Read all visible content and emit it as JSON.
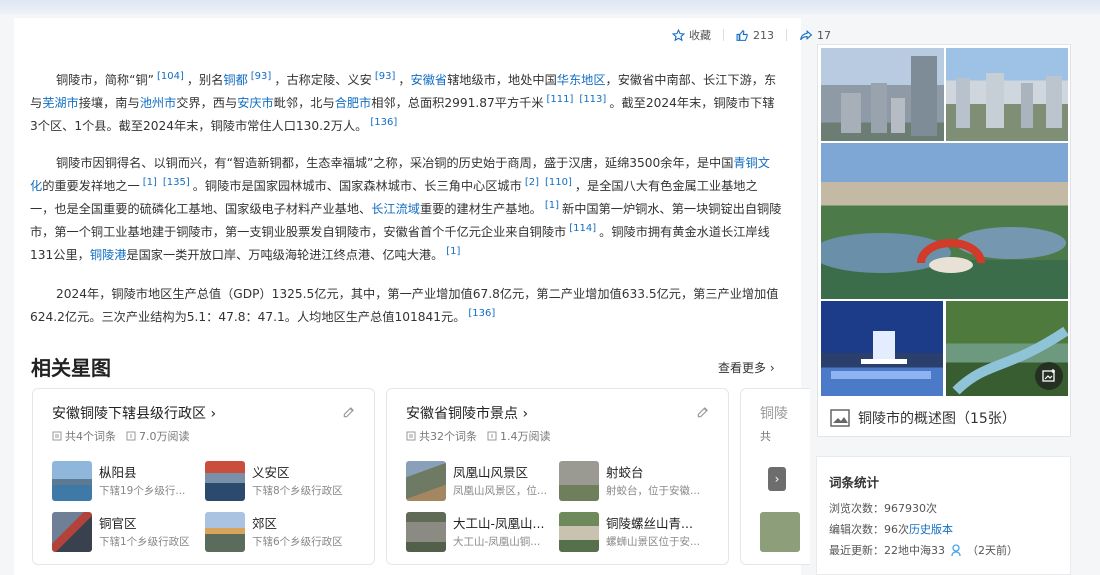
{
  "actions": {
    "favorite_label": "收藏",
    "like_count": "213",
    "share_count": "17"
  },
  "article": {
    "p1": {
      "t1": "铜陵市，简称“铜”",
      "r1": "[104]",
      "t2": "，别名",
      "l1": "铜都",
      "r2": "[93]",
      "t3": "，古称定陵、义安",
      "r3": "[93]",
      "t4": "，",
      "l2": "安徽省",
      "t5": "辖地级市，地处中国",
      "l3": "华东地区",
      "t6": "，安徽省中南部、长江下游，东与",
      "l4": "芜湖市",
      "t7": "接壤，南与",
      "l5": "池州市",
      "t8": "交界，西与",
      "l6": "安庆市",
      "t9": "毗邻，北与",
      "l7": "合肥市",
      "t10": "相邻，总面积2991.87平方千米",
      "r4": "[111]",
      "r5": "[113]",
      "t11": "。截至2024年末，铜陵市下辖3个区、1个县。截至2024年末，铜陵市常住人口130.2万人。",
      "r6": "[136]"
    },
    "p2": {
      "t1": "铜陵市因铜得名、以铜而兴，有“智造新铜都，生态幸福城”之称，采冶铜的历史始于商周，盛于汉唐，延绵3500余年，是中国",
      "l1": "青铜文化",
      "t2": "的重要发祥地之一",
      "r1": "[1]",
      "r2": "[135]",
      "t3": "。铜陵市是国家园林城市、国家森林城市、长三角中心区城市",
      "r3": "[2]",
      "r4": "[110]",
      "t4": "，是全国八大有色金属工业基地之一，也是全国重要的硫磷化工基地、国家级电子材料产业基地、",
      "l2": "长江流域",
      "t5": "重要的建材生产基地。",
      "r5": "[1]",
      "t6": "新中国第一炉铜水、第一块铜锭出自铜陵市，第一个铜工业基地建于铜陵市，第一支铜业股票发自铜陵市，安徽省首个千亿元企业来自铜陵市",
      "r6": "[114]",
      "t7": "。铜陵市拥有黄金水道长江岸线131公里，",
      "l3": "铜陵港",
      "t8": "是国家一类开放口岸、万吨级海轮进江终点港、亿吨大港。",
      "r7": "[1]"
    },
    "p3": {
      "t1": "2024年，铜陵市地区生产总值（GDP）1325.5亿元，其中，第一产业增加值67.8亿元，第二产业增加值633.5亿元，第三产业增加值624.2亿元。三次产业结构为5.1：47.8：47.1。人均地区生产总值101841元。",
      "r1": "[136]"
    }
  },
  "related": {
    "title": "相关星图",
    "more_label": "查看更多",
    "cards": [
      {
        "title": "安徽铜陵下辖县级行政区",
        "entries": "共4个词条",
        "reads": "7.0万阅读",
        "items": [
          {
            "name": "枞阳县",
            "desc": "下辖19个乡级行..."
          },
          {
            "name": "义安区",
            "desc": "下辖8个乡级行政区"
          },
          {
            "name": "铜官区",
            "desc": "下辖1个乡级行政区"
          },
          {
            "name": "郊区",
            "desc": "下辖6个乡级行政区"
          }
        ]
      },
      {
        "title": "安徽省铜陵市景点",
        "entries": "共32个词条",
        "reads": "1.4万阅读",
        "items": [
          {
            "name": "凤凰山风景区",
            "desc": "凤凰山风景区，位..."
          },
          {
            "name": "射蛟台",
            "desc": "射蛟台，位于安徽..."
          },
          {
            "name": "大工山-凤凰山...",
            "desc": "大工山-凤凰山铜..."
          },
          {
            "name": "铜陵螺丝山青...",
            "desc": "螺蛳山景区位于安..."
          }
        ]
      },
      {
        "title": "铜陵",
        "entries": "共",
        "reads": ""
      }
    ]
  },
  "gallery": {
    "caption": "铜陵市的概述图（15张）"
  },
  "stats": {
    "title": "词条统计",
    "views_label": "浏览次数：",
    "views": "967930次",
    "edits_label": "编辑次数：",
    "edits": "96次",
    "history_link": "历史版本",
    "updated_label": "最近更新：",
    "updated_user": "22地中海33",
    "updated_when": "（2天前）"
  },
  "colors": {
    "link": "#136ec2",
    "page_bg": "#f5f6f8"
  }
}
